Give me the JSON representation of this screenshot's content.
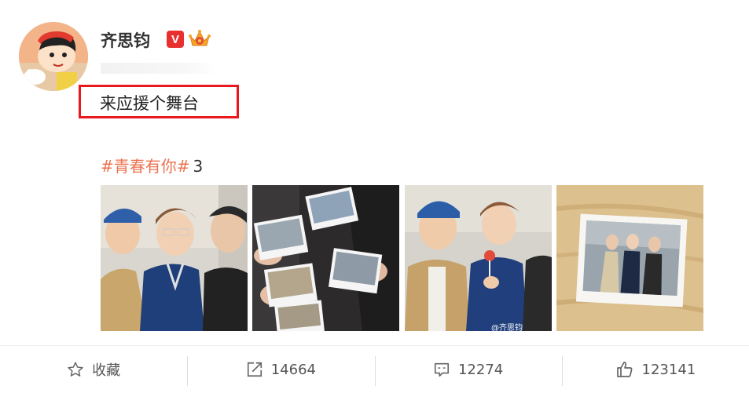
{
  "user": {
    "name": "齐思钧",
    "verified_badge": "V"
  },
  "post": {
    "text": "来应援个舞台",
    "hashtag": "#青春有你#",
    "hashtag_suffix": "3"
  },
  "photos": [
    {
      "watermark": ""
    },
    {
      "watermark": ""
    },
    {
      "watermark": "@齐思钧"
    },
    {
      "watermark": ""
    }
  ],
  "actions": {
    "favorite_label": "收藏",
    "repost_count": "14664",
    "comment_count": "12274",
    "like_count": "123141"
  },
  "colors": {
    "hashtag": "#eb7350",
    "highlight_box": "#e8181c",
    "verified": "#e8302e"
  }
}
